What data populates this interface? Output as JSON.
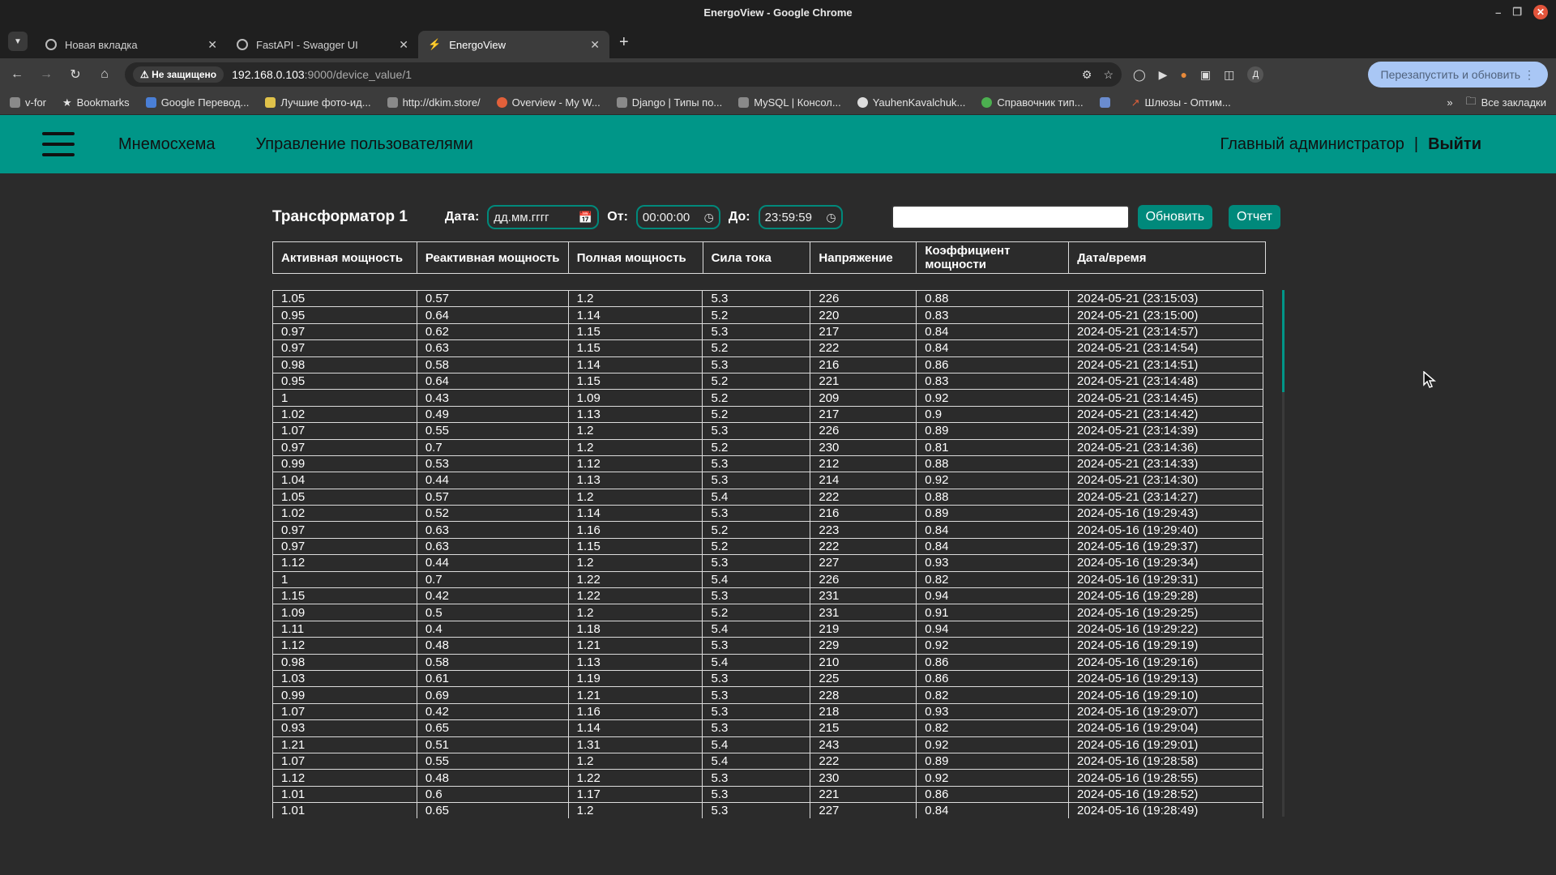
{
  "window": {
    "title": "EnergoView - Google Chrome"
  },
  "tabs": [
    {
      "title": "Новая вкладка",
      "icon": "chrome-icon",
      "active": false
    },
    {
      "title": "FastAPI - Swagger UI",
      "icon": "globe-icon",
      "active": false
    },
    {
      "title": "EnergoView",
      "icon": "lightning-icon",
      "active": true
    }
  ],
  "address_bar": {
    "security": "Не защищено",
    "host": "192.168.0.103",
    "rest": ":9000/device_value/1"
  },
  "relaunch_label": "Перезапустить и обновить",
  "profile_initial": "Д",
  "bookmarks": [
    "v-for",
    "Bookmarks",
    "Google Перевод...",
    "Лучшие фото-ид...",
    "http://dkim.store/",
    "Overview - My W...",
    "Django | Типы по...",
    "MySQL | Консол...",
    "YauhenKavalchuk...",
    "Справочник тип...",
    "",
    "Шлюзы - Оптим..."
  ],
  "bookmarks_all": "Все закладки",
  "header": {
    "nav": [
      "Мнемосхема",
      "Управление пользователями"
    ],
    "user": "Главный администратор",
    "separator": "|",
    "logout": "Выйти"
  },
  "page": {
    "title": "Трансформатор 1",
    "date_label": "Дата:",
    "date_placeholder": "дд.мм.гггг",
    "from_label": "От:",
    "from_value": "00:00:00",
    "to_label": "До:",
    "to_value": "23:59:59",
    "search_value": "",
    "refresh_button": "Обновить",
    "report_button": "Отчет"
  },
  "table": {
    "columns": [
      "Активная мощность",
      "Реактивная мощность",
      "Полная мощность",
      "Сила тока",
      "Напряжение",
      "Коэффициент мощности",
      "Дата/время"
    ],
    "rows": [
      [
        "1.05",
        "0.57",
        "1.2",
        "5.3",
        "226",
        "0.88",
        "2024-05-21 (23:15:03)"
      ],
      [
        "0.95",
        "0.64",
        "1.14",
        "5.2",
        "220",
        "0.83",
        "2024-05-21 (23:15:00)"
      ],
      [
        "0.97",
        "0.62",
        "1.15",
        "5.3",
        "217",
        "0.84",
        "2024-05-21 (23:14:57)"
      ],
      [
        "0.97",
        "0.63",
        "1.15",
        "5.2",
        "222",
        "0.84",
        "2024-05-21 (23:14:54)"
      ],
      [
        "0.98",
        "0.58",
        "1.14",
        "5.3",
        "216",
        "0.86",
        "2024-05-21 (23:14:51)"
      ],
      [
        "0.95",
        "0.64",
        "1.15",
        "5.2",
        "221",
        "0.83",
        "2024-05-21 (23:14:48)"
      ],
      [
        "1",
        "0.43",
        "1.09",
        "5.2",
        "209",
        "0.92",
        "2024-05-21 (23:14:45)"
      ],
      [
        "1.02",
        "0.49",
        "1.13",
        "5.2",
        "217",
        "0.9",
        "2024-05-21 (23:14:42)"
      ],
      [
        "1.07",
        "0.55",
        "1.2",
        "5.3",
        "226",
        "0.89",
        "2024-05-21 (23:14:39)"
      ],
      [
        "0.97",
        "0.7",
        "1.2",
        "5.2",
        "230",
        "0.81",
        "2024-05-21 (23:14:36)"
      ],
      [
        "0.99",
        "0.53",
        "1.12",
        "5.3",
        "212",
        "0.88",
        "2024-05-21 (23:14:33)"
      ],
      [
        "1.04",
        "0.44",
        "1.13",
        "5.3",
        "214",
        "0.92",
        "2024-05-21 (23:14:30)"
      ],
      [
        "1.05",
        "0.57",
        "1.2",
        "5.4",
        "222",
        "0.88",
        "2024-05-21 (23:14:27)"
      ],
      [
        "1.02",
        "0.52",
        "1.14",
        "5.3",
        "216",
        "0.89",
        "2024-05-16 (19:29:43)"
      ],
      [
        "0.97",
        "0.63",
        "1.16",
        "5.2",
        "223",
        "0.84",
        "2024-05-16 (19:29:40)"
      ],
      [
        "0.97",
        "0.63",
        "1.15",
        "5.2",
        "222",
        "0.84",
        "2024-05-16 (19:29:37)"
      ],
      [
        "1.12",
        "0.44",
        "1.2",
        "5.3",
        "227",
        "0.93",
        "2024-05-16 (19:29:34)"
      ],
      [
        "1",
        "0.7",
        "1.22",
        "5.4",
        "226",
        "0.82",
        "2024-05-16 (19:29:31)"
      ],
      [
        "1.15",
        "0.42",
        "1.22",
        "5.3",
        "231",
        "0.94",
        "2024-05-16 (19:29:28)"
      ],
      [
        "1.09",
        "0.5",
        "1.2",
        "5.2",
        "231",
        "0.91",
        "2024-05-16 (19:29:25)"
      ],
      [
        "1.11",
        "0.4",
        "1.18",
        "5.4",
        "219",
        "0.94",
        "2024-05-16 (19:29:22)"
      ],
      [
        "1.12",
        "0.48",
        "1.21",
        "5.3",
        "229",
        "0.92",
        "2024-05-16 (19:29:19)"
      ],
      [
        "0.98",
        "0.58",
        "1.13",
        "5.4",
        "210",
        "0.86",
        "2024-05-16 (19:29:16)"
      ],
      [
        "1.03",
        "0.61",
        "1.19",
        "5.3",
        "225",
        "0.86",
        "2024-05-16 (19:29:13)"
      ],
      [
        "0.99",
        "0.69",
        "1.21",
        "5.3",
        "228",
        "0.82",
        "2024-05-16 (19:29:10)"
      ],
      [
        "1.07",
        "0.42",
        "1.16",
        "5.3",
        "218",
        "0.93",
        "2024-05-16 (19:29:07)"
      ],
      [
        "0.93",
        "0.65",
        "1.14",
        "5.3",
        "215",
        "0.82",
        "2024-05-16 (19:29:04)"
      ],
      [
        "1.21",
        "0.51",
        "1.31",
        "5.4",
        "243",
        "0.92",
        "2024-05-16 (19:29:01)"
      ],
      [
        "1.07",
        "0.55",
        "1.2",
        "5.4",
        "222",
        "0.89",
        "2024-05-16 (19:28:58)"
      ],
      [
        "1.12",
        "0.48",
        "1.22",
        "5.3",
        "230",
        "0.92",
        "2024-05-16 (19:28:55)"
      ],
      [
        "1.01",
        "0.6",
        "1.17",
        "5.3",
        "221",
        "0.86",
        "2024-05-16 (19:28:52)"
      ],
      [
        "1.01",
        "0.65",
        "1.2",
        "5.3",
        "227",
        "0.84",
        "2024-05-16 (19:28:49)"
      ]
    ]
  },
  "colors": {
    "accent": "#009688",
    "page_bg": "#2b2b2b",
    "button": "#00897b"
  }
}
